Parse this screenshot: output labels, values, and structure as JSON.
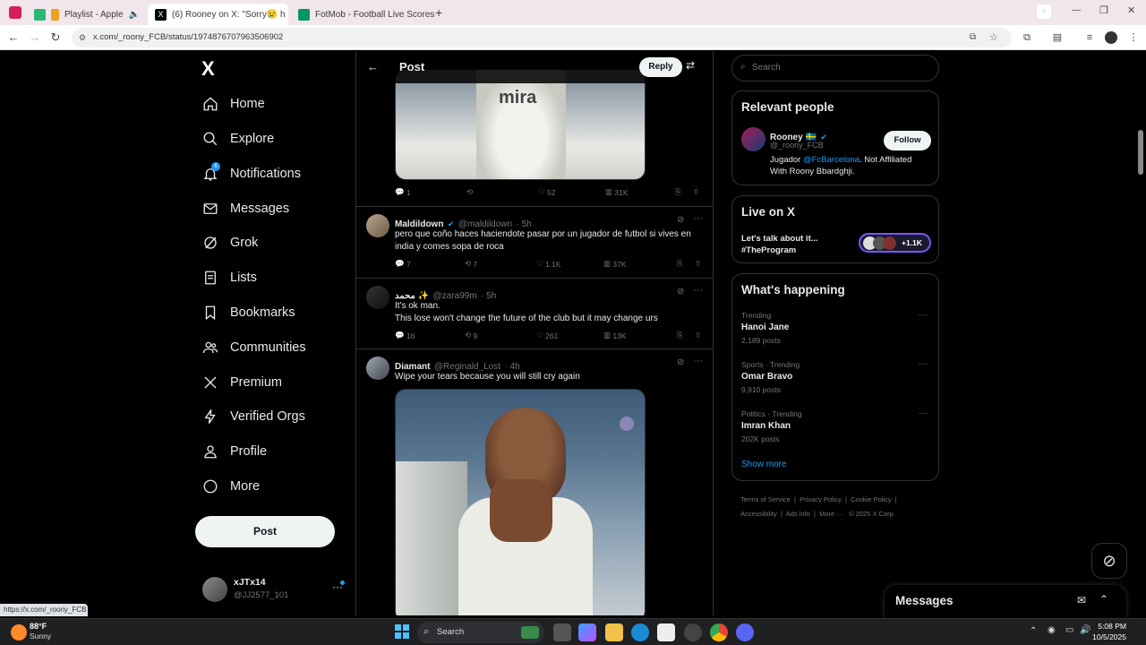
{
  "browser": {
    "tabs": [
      {
        "title": "Playlist - Apple",
        "favicon_color": "#fa243c"
      },
      {
        "title": "(6) Rooney on X: \"Sorry😢 h",
        "favicon_color": "#000000"
      },
      {
        "title": "FotMob - Football Live Scores",
        "favicon_color": "#00985f"
      }
    ],
    "url": "x.com/_roony_FCB/status/1974876707963506902",
    "status_url": "https://x.com/_roony_FCB"
  },
  "nav": {
    "logo": "X",
    "items": [
      {
        "label": "Home",
        "icon": "home-icon"
      },
      {
        "label": "Explore",
        "icon": "search-icon"
      },
      {
        "label": "Notifications",
        "icon": "bell-icon"
      },
      {
        "label": "Messages",
        "icon": "mail-icon"
      },
      {
        "label": "Grok",
        "icon": "grok-icon"
      },
      {
        "label": "Lists",
        "icon": "list-icon"
      },
      {
        "label": "Bookmarks",
        "icon": "bookmark-icon"
      },
      {
        "label": "Communities",
        "icon": "people-icon"
      },
      {
        "label": "Premium",
        "icon": "x-icon"
      },
      {
        "label": "Verified Orgs",
        "icon": "lightning-icon"
      },
      {
        "label": "Profile",
        "icon": "user-icon"
      },
      {
        "label": "More",
        "icon": "more-circle-icon"
      }
    ],
    "post_label": "Post",
    "account": {
      "name": "xJTx14",
      "handle": "@JJ2577_101"
    }
  },
  "feed": {
    "header_title": "Post",
    "reply_label": "Reply",
    "top_actions": {
      "replies": "1",
      "reposts": "",
      "likes": "52",
      "views": "31K"
    },
    "tweets": [
      {
        "name": "Maldildown",
        "verified": true,
        "handle": "@maldildown",
        "time": "· 5h",
        "text": "pero que coño haces haciendote pasar por un jugador de futbol si vives en india y comes sopa de roca",
        "replies": "7",
        "reposts": "7",
        "likes": "1.1K",
        "views": "37K"
      },
      {
        "name": "محمد ✨",
        "verified": false,
        "handle": "@zara99m",
        "time": "· 5h",
        "text": "It's ok man.",
        "text2": "This lose won't change the future of the club but it may change urs",
        "replies": "16",
        "reposts": "9",
        "likes": "261",
        "views": "13K"
      },
      {
        "name": "Diamant",
        "verified": false,
        "handle": "@Reginald_Lost",
        "time": "· 4h",
        "text": "Wipe your tears because you will still cry again"
      }
    ]
  },
  "right": {
    "search_placeholder": "Search",
    "relevant": {
      "title": "Relevant people",
      "name": "Rooney 🇸🇪",
      "handle": "@_roony_FCB",
      "follow_label": "Follow",
      "bio_pre": "Jugador ",
      "bio_link": "@FcBarcelona",
      "bio_post": ". Not Affiliated With Roony Bbardghji."
    },
    "live": {
      "title": "Live on X",
      "line1": "Let's talk about it...",
      "line2": "#TheProgram",
      "count": "+1.1K"
    },
    "happening": {
      "title": "What's happening",
      "items": [
        {
          "meta": "Trending",
          "name": "Hanoi Jane",
          "posts": "2,189 posts"
        },
        {
          "meta": "Sports · Trending",
          "name": "Omar Bravo",
          "posts": "9,910 posts"
        },
        {
          "meta": "Politics · Trending",
          "name": "Imran Khan",
          "posts": "202K posts"
        }
      ],
      "show_more": "Show more"
    },
    "footer": [
      "Terms of Service",
      "Privacy Policy",
      "Cookie Policy",
      "Accessibility",
      "Ads info",
      "More ···",
      "© 2025 X Corp."
    ],
    "messages_label": "Messages"
  },
  "taskbar": {
    "weather_temp": "88°F",
    "weather_desc": "Sunny",
    "search_label": "Search",
    "time": "5:08 PM",
    "date": "10/5/2025"
  }
}
